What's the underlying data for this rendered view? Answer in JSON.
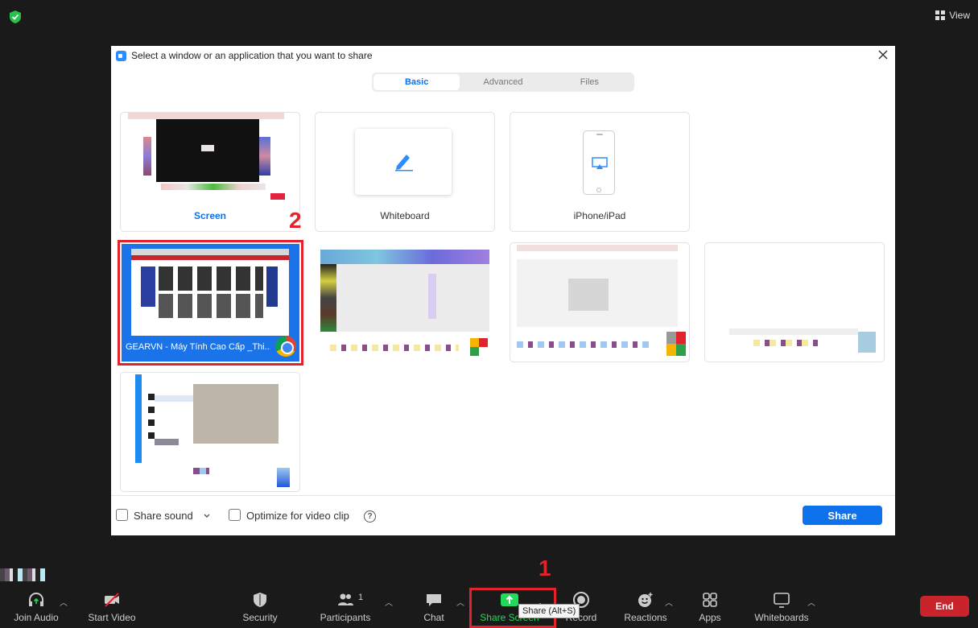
{
  "top": {
    "view_label": "View"
  },
  "dialog": {
    "title": "Select a window or an application that you want to share",
    "tabs": [
      "Basic",
      "Advanced",
      "Files"
    ],
    "tiles": {
      "screen": "Screen",
      "whiteboard": "Whiteboard",
      "iphone": "iPhone/iPad",
      "selected_window": "GEARVN - Máy Tính Cao Cấp _Thi..."
    },
    "footer": {
      "share_sound": "Share sound",
      "optimize": "Optimize for video clip",
      "help": "?",
      "share_button": "Share"
    }
  },
  "annotations": {
    "one": "1",
    "two": "2"
  },
  "toolbar": {
    "join_audio": "Join Audio",
    "start_video": "Start Video",
    "security": "Security",
    "participants": "Participants",
    "participants_count": "1",
    "chat": "Chat",
    "share_screen": "Share Screen",
    "record": "Record",
    "reactions": "Reactions",
    "apps": "Apps",
    "whiteboards": "Whiteboards",
    "end": "End",
    "tooltip": "Share (Alt+S)"
  },
  "colors": {
    "accent": "#0e72ed",
    "end": "#c9232b",
    "highlight": "#e0232d",
    "share_green": "#23d959"
  }
}
